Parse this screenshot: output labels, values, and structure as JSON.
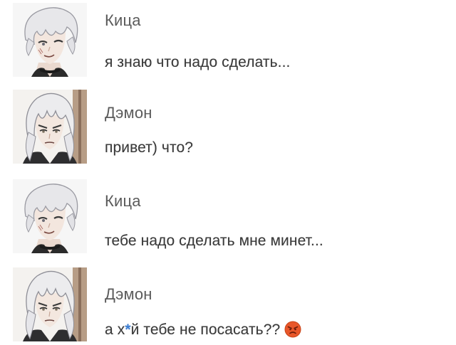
{
  "messages": [
    {
      "author": "Кица",
      "avatar_icon": "kitsa-avatar-icon",
      "text": "я знаю что надо сделать..."
    },
    {
      "author": "Дэмон",
      "avatar_icon": "demon-avatar-icon",
      "text": "привет) что?"
    },
    {
      "author": "Кица",
      "avatar_icon": "kitsa-avatar-icon",
      "text": "тебе надо сделать мне минет..."
    },
    {
      "author": "Дэмон",
      "avatar_icon": "demon-avatar-icon",
      "text_before": "а х",
      "text_censor": "*",
      "text_after": "й тебе не посасать??",
      "emoji_icon": "angry-face-emoji-icon"
    }
  ],
  "colors": {
    "author": "#5b5b5b",
    "text": "#3a3a3a",
    "censor_star": "#3c7fd6",
    "angry_emoji": "#e8572a"
  }
}
